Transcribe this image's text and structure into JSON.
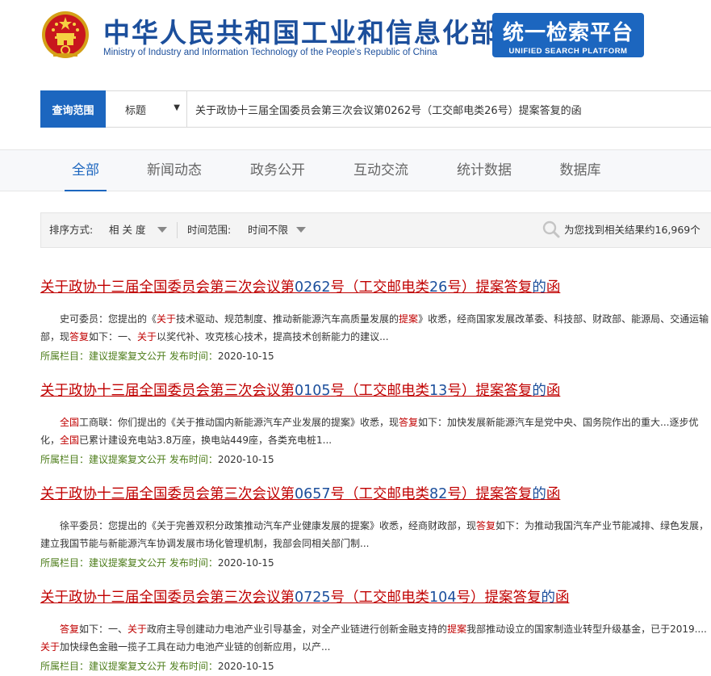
{
  "header": {
    "title_cn": "中华人民共和国工业和信息化部",
    "title_en": "Ministry of Industry and Information Technology of the People's Republic of China",
    "platform_cn": "统一检索平台",
    "platform_en": "UNIFIED SEARCH PLATFORM",
    "brand_color": "#1c66bf"
  },
  "search": {
    "scope_label": "查询范围",
    "scope_selected": "标题",
    "query": "关于政协十三届全国委员会第三次会议第0262号（工交邮电类26号）提案答复的函"
  },
  "tabs": [
    {
      "label": "全部",
      "active": true
    },
    {
      "label": "新闻动态",
      "active": false
    },
    {
      "label": "政务公开",
      "active": false
    },
    {
      "label": "互动交流",
      "active": false
    },
    {
      "label": "统计数据",
      "active": false
    },
    {
      "label": "数据库",
      "active": false
    }
  ],
  "filters": {
    "sort_label": "排序方式:",
    "sort_value": "相 关 度",
    "time_label": "时间范围:",
    "time_value": "时间不限",
    "result_count": "为您找到相关结果约16,969个"
  },
  "results": [
    {
      "title_red_1": "关于政协十三届全国委员会第三次会议第",
      "title_blue_1": "0262",
      "title_red_2": "号（工交邮电类",
      "title_blue_2": "26",
      "title_red_3": "号）提案答复",
      "title_blue_3": "的",
      "title_red_4": "函",
      "summary": [
        {
          "t": "史可委员：您提出的《",
          "h": false
        },
        {
          "t": "关于",
          "h": true
        },
        {
          "t": "技术驱动、规范制度、推动新能源汽车高质量发展的",
          "h": false
        },
        {
          "t": "提案",
          "h": true
        },
        {
          "t": "》收悉，经商国家发展改革委、科技部、财政部、能源局、交通运输部，现",
          "h": false
        },
        {
          "t": "答复",
          "h": true
        },
        {
          "t": "如下：一、",
          "h": false
        },
        {
          "t": "关于",
          "h": true
        },
        {
          "t": "以奖代补、攻克核心技术，提高技术创新能力的建议...",
          "h": false
        }
      ],
      "meta_label": "所属栏目：",
      "category": "建议提案复文公开",
      "date_label": "发布时间：",
      "date": "2020-10-15"
    },
    {
      "title_red_1": "关于政协十三届全国委员会第三次会议第",
      "title_blue_1": "0105",
      "title_red_2": "号（工交邮电类",
      "title_blue_2": "13",
      "title_red_3": "号）提案答复",
      "title_blue_3": "的",
      "title_red_4": "函",
      "summary": [
        {
          "t": "全国",
          "h": true
        },
        {
          "t": "工商联：你们提出的《关于推动国内新能源汽车产业发展的提案》收悉，现",
          "h": false
        },
        {
          "t": "答复",
          "h": true
        },
        {
          "t": "如下：加快发展新能源汽车是党中央、国务院作出的重大...逐步优化，",
          "h": false
        },
        {
          "t": "全国",
          "h": true
        },
        {
          "t": "已累计建设充电站3.8万座，换电站449座，各类充电桩1...",
          "h": false
        }
      ],
      "meta_label": "所属栏目：",
      "category": "建议提案复文公开",
      "date_label": "发布时间：",
      "date": "2020-10-15"
    },
    {
      "title_red_1": "关于政协十三届全国委员会第三次会议第",
      "title_blue_1": "0657",
      "title_red_2": "号（工交邮电类",
      "title_blue_2": "82",
      "title_red_3": "号）提案答复",
      "title_blue_3": "的",
      "title_red_4": "函",
      "summary": [
        {
          "t": "徐平委员：您提出的《关于完善双积分政策推动汽车产业健康发展的提案》收悉，经商财政部，现",
          "h": false
        },
        {
          "t": "答复",
          "h": true
        },
        {
          "t": "如下：为推动我国汽车产业节能减排、绿色发展，建立我国节能与新能源汽车协调发展市场化管理机制，我部会同相关部门制...",
          "h": false
        }
      ],
      "meta_label": "所属栏目：",
      "category": "建议提案复文公开",
      "date_label": "发布时间：",
      "date": "2020-10-15"
    },
    {
      "title_red_1": "关于政协十三届全国委员会第三次会议第",
      "title_blue_1": "0725",
      "title_red_2": "号（工交邮电类",
      "title_blue_2": "104",
      "title_red_3": "号）提案答复",
      "title_blue_3": "的",
      "title_red_4": "函",
      "summary": [
        {
          "t": "答复",
          "h": true
        },
        {
          "t": "如下：一、",
          "h": false
        },
        {
          "t": "关于",
          "h": true
        },
        {
          "t": "政府主导创建动力电池产业引导基金，对全产业链进行创新金融支持的",
          "h": false
        },
        {
          "t": "提案",
          "h": true
        },
        {
          "t": "我部推动设立的国家制造业转型升级基金，已于2019....",
          "h": false
        },
        {
          "t": "关于",
          "h": true
        },
        {
          "t": "加快绿色金融一揽子工具在动力电池产业链的创新应用，以产...",
          "h": false
        }
      ],
      "meta_label": "所属栏目：",
      "category": "建议提案复文公开",
      "date_label": "发布时间：",
      "date": "2020-10-15"
    }
  ]
}
